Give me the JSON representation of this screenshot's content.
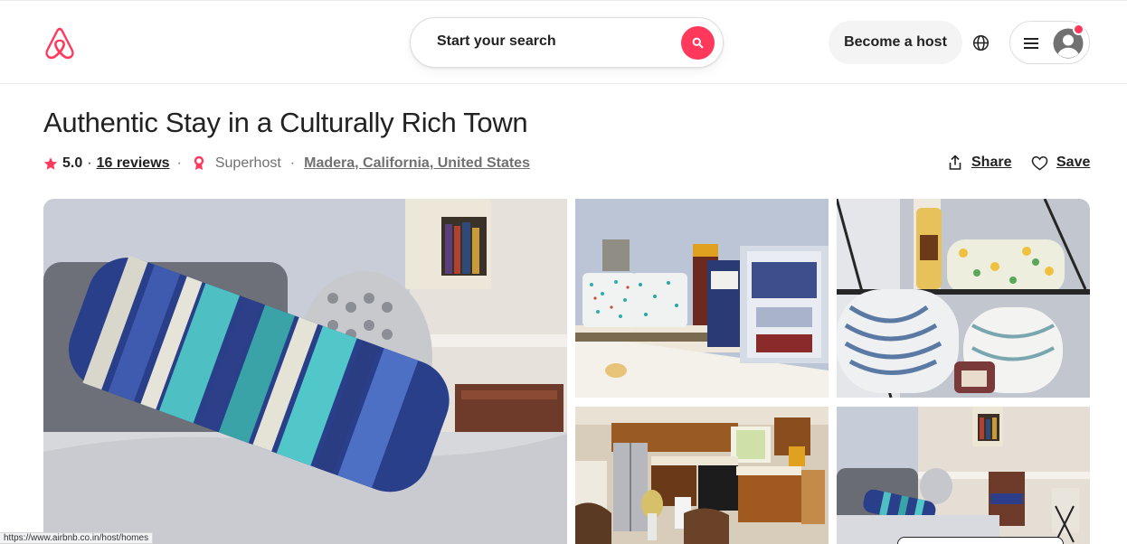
{
  "header": {
    "search_label": "Start your search",
    "host_label": "Become a host",
    "logo_icon": "airbnb-logo-icon",
    "brand_color": "#ff385c"
  },
  "listing": {
    "title": "Authentic Stay in a Culturally Rich Town",
    "rating": "5.0",
    "reviews": "16 reviews",
    "superhost": "Superhost",
    "location": "Madera, California, United States",
    "share_label": "Share",
    "save_label": "Save"
  },
  "photos": [
    {
      "name": "photo-bedroom-pillow"
    },
    {
      "name": "photo-mugs-tea-shelf"
    },
    {
      "name": "photo-towels-shelf"
    },
    {
      "name": "photo-kitchen"
    },
    {
      "name": "photo-bedroom-wide"
    }
  ],
  "status_bar": {
    "url": "https://www.airbnb.co.in/host/homes"
  }
}
